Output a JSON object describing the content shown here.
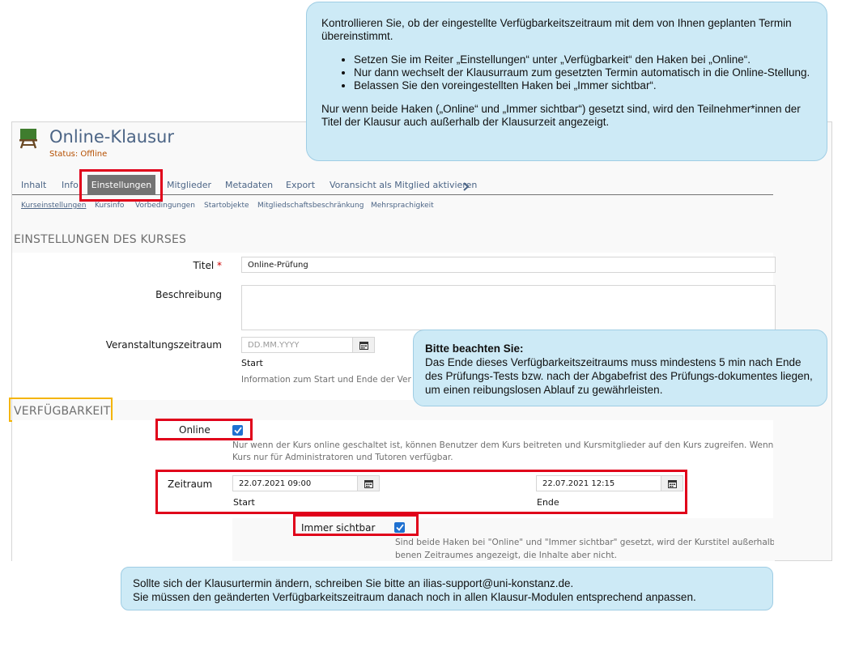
{
  "course": {
    "title": "Online-Klausur",
    "status": "Status: Offline"
  },
  "tabs": [
    {
      "label": "Inhalt"
    },
    {
      "label": "Info"
    },
    {
      "label": "Einstellungen"
    },
    {
      "label": "Mitglieder"
    },
    {
      "label": "Metadaten"
    },
    {
      "label": "Export"
    },
    {
      "label": "Voransicht als Mitglied aktivieren"
    }
  ],
  "subtabs": [
    {
      "label": "Kurseinstellungen"
    },
    {
      "label": "Kursinfo"
    },
    {
      "label": "Vorbedingungen"
    },
    {
      "label": "Startobjekte"
    },
    {
      "label": "Mitgliedschaftsbeschränkung"
    },
    {
      "label": "Mehrsprachigkeit"
    }
  ],
  "settings": {
    "section_title": "EINSTELLUNGEN DES KURSES",
    "title_label": "Titel",
    "required_mark": "*",
    "title_value": "Online-Prüfung",
    "description_label": "Beschreibung",
    "period_label": "Veranstaltungszeitraum",
    "period_placeholder": "DD.MM.YYYY",
    "period_start": "Start",
    "period_info": "Information zum Start und Ende der Veranstaltung"
  },
  "availability": {
    "section_title": "VERFÜGBARKEIT",
    "online_label": "Online",
    "online_help_1": "Nur wenn der Kurs online geschaltet ist, können Benutzer dem Kurs beitreten und Kursmitglieder auf den Kurs zugreifen. Wenn",
    "online_help_2": "Kurs nur für Administratoren und Tutoren verfügbar.",
    "period_label": "Zeitraum",
    "start_value": "22.07.2021 09:00",
    "start_label": "Start",
    "end_value": "22.07.2021 12:15",
    "end_label": "Ende",
    "always_visible_label": "Immer sichtbar",
    "visible_help_1": "Sind beide Haken bei \"Online\" und \"Immer sichtbar\" gesetzt, wird der Kurstitel außerhalb",
    "visible_help_2": "benen Zeitraumes angezeigt, die Inhalte aber nicht."
  },
  "callouts": {
    "top": {
      "intro": "Kontrollieren Sie, ob der eingestellte Verfügbarkeitszeitraum mit dem von Ihnen geplanten Termin übereinstimmt.",
      "bullets": [
        "Setzen Sie im Reiter „Einstellungen“ unter „Verfügbarkeit“ den Haken bei „Online“.",
        "Nur dann wechselt der Klausurraum zum gesetzten Termin automatisch in die Online-Stellung.",
        "Belassen Sie den voreingestellten Haken bei „Immer sichtbar“."
      ],
      "outro": "Nur wenn beide Haken („Online“ und „Immer sichtbar“) gesetzt sind, wird den Teilnehmer*innen der Titel der Klausur auch außerhalb der Klausurzeit angezeigt."
    },
    "mid": {
      "heading": "Bitte beachten Sie:",
      "text": "Das Ende dieses Verfügbarkeitszeitraums muss mindestens 5 min nach Ende des Prüfungs-Tests bzw. nach der Abgabefrist des Prüfungs-dokumentes liegen, um einen reibungslosen Ablauf zu gewährleisten."
    },
    "bottom": {
      "line1": "Sollte sich der Klausurtermin ändern, schreiben Sie bitte an ilias-support@uni-konstanz.de.",
      "line2": "Sie müssen den geänderten Verfügbarkeitszeitraum danach noch in allen Klausur-Modulen entsprechend anpassen."
    }
  },
  "icons": {
    "course": "easel-icon",
    "calendar": "calendar-icon",
    "chevron": "chevron-right-icon",
    "check": "checkmark-icon"
  },
  "colors": {
    "highlight_red": "#e0001a",
    "highlight_yellow": "#f4b400",
    "callout_bg": "#cdeaf6",
    "link": "#4c6586",
    "status": "#b54f00",
    "checkbox": "#1f71d1"
  }
}
